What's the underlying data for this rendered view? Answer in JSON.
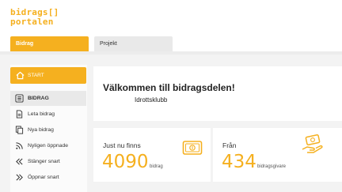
{
  "logo": {
    "line1": "bidrags[]",
    "line2": "portalen"
  },
  "tabs": {
    "bidrag": "Bidrag",
    "projekt": "Projekt"
  },
  "sidebar": {
    "start_label": "START",
    "items": [
      {
        "label": "BIDRAG",
        "icon": "list-icon"
      },
      {
        "label": "Leta bidrag",
        "icon": "document-icon"
      },
      {
        "label": "Nya bidrag",
        "icon": "copy-icon"
      },
      {
        "label": "Nyligen öppnade",
        "icon": "rss-icon"
      },
      {
        "label": "Stänger snart",
        "icon": "double-chevron-left-icon"
      },
      {
        "label": "Öppnar snart",
        "icon": "double-chevron-right-icon"
      }
    ]
  },
  "welcome": {
    "title": "Välkommen till bidragsdelen!",
    "club": "Idrottsklubb"
  },
  "stats": {
    "left": {
      "label": "Just nu finns",
      "value": "4090",
      "unit": "bidrag",
      "icon": "money-bill-icon"
    },
    "right": {
      "label": "Från",
      "value": "434",
      "unit": "bidragsgivare",
      "icon": "hand-money-icon"
    }
  },
  "colors": {
    "accent": "#f5b01f",
    "content_bg": "#f3f3f3"
  }
}
